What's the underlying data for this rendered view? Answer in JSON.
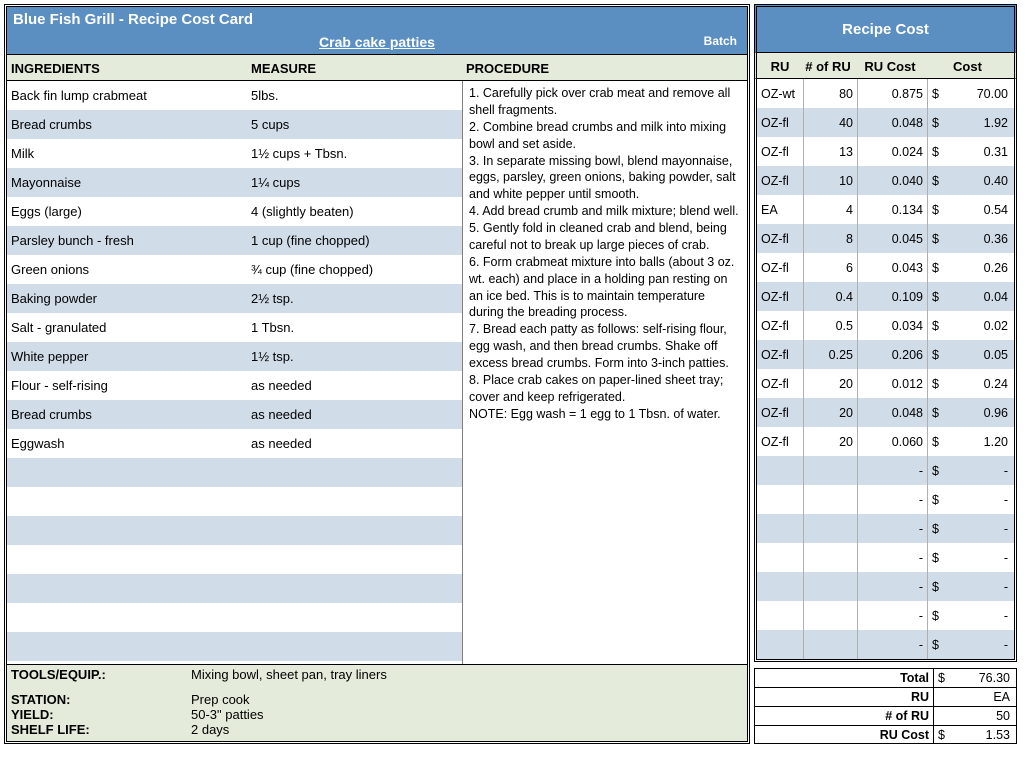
{
  "header": {
    "title": "Blue Fish Grill - Recipe Cost Card",
    "recipe_name": "Crab cake patties",
    "batch_label": "Batch"
  },
  "columns": {
    "ingredients": "INGREDIENTS",
    "measure": "MEASURE",
    "procedure": "PROCEDURE"
  },
  "ingredients": [
    {
      "name": "Back fin lump crabmeat",
      "measure": "5lbs."
    },
    {
      "name": "Bread crumbs",
      "measure": "5 cups"
    },
    {
      "name": "Milk",
      "measure": "1½ cups + Tbsn."
    },
    {
      "name": "Mayonnaise",
      "measure": "1¼ cups"
    },
    {
      "name": "Eggs (large)",
      "measure": "4 (slightly beaten)"
    },
    {
      "name": "Parsley bunch - fresh",
      "measure": "1 cup (fine chopped)"
    },
    {
      "name": "Green onions",
      "measure": "¾ cup (fine chopped)"
    },
    {
      "name": "Baking powder",
      "measure": "2½ tsp."
    },
    {
      "name": "Salt - granulated",
      "measure": "1 Tbsn."
    },
    {
      "name": "White pepper",
      "measure": "1½ tsp."
    },
    {
      "name": "Flour - self-rising",
      "measure": "as needed"
    },
    {
      "name": "Bread crumbs",
      "measure": "as needed"
    },
    {
      "name": "Eggwash",
      "measure": "as needed"
    },
    {
      "name": "",
      "measure": ""
    },
    {
      "name": "",
      "measure": ""
    },
    {
      "name": "",
      "measure": ""
    },
    {
      "name": "",
      "measure": ""
    },
    {
      "name": "",
      "measure": ""
    },
    {
      "name": "",
      "measure": ""
    },
    {
      "name": "",
      "measure": ""
    }
  ],
  "procedure": [
    "1. Carefully pick over crab meat and remove all shell fragments.",
    "2. Combine bread crumbs and milk into mixing bowl and set aside.",
    "3. In separate missing bowl, blend mayonnaise, eggs, parsley, green onions, baking powder, salt and white pepper until smooth.",
    "4. Add bread crumb and milk mixture; blend well.",
    "5. Gently fold in cleaned crab and blend, being careful not to break up large pieces of crab.",
    "6. Form crabmeat mixture into balls (about 3 oz. wt. each) and place in a holding pan resting on an ice bed. This is to maintain temperature during the breading process.",
    "7. Bread each patty as follows: self-rising flour, egg wash, and then bread crumbs. Shake off excess bread crumbs. Form into 3-inch patties.",
    "8. Place crab cakes on paper-lined sheet tray; cover and keep refrigerated.",
    "NOTE: Egg wash = 1 egg to 1 Tbsn. of water."
  ],
  "footer": {
    "tools_label": "TOOLS/EQUIP.:",
    "tools": "Mixing bowl, sheet pan, tray liners",
    "station_label": "STATION:",
    "station": "Prep cook",
    "yield_label": "YIELD:",
    "yield": "50-3\" patties",
    "shelf_label": "SHELF LIFE:",
    "shelf": "2 days"
  },
  "recipe_cost": {
    "title": "Recipe Cost",
    "cols": {
      "ru": "RU",
      "num_ru": "# of RU",
      "ru_cost": "RU Cost",
      "cost": "Cost"
    },
    "rows": [
      {
        "ru": "OZ-wt",
        "n": "80",
        "rc": "0.875",
        "c": "70.00"
      },
      {
        "ru": "OZ-fl",
        "n": "40",
        "rc": "0.048",
        "c": "1.92"
      },
      {
        "ru": "OZ-fl",
        "n": "13",
        "rc": "0.024",
        "c": "0.31"
      },
      {
        "ru": "OZ-fl",
        "n": "10",
        "rc": "0.040",
        "c": "0.40"
      },
      {
        "ru": "EA",
        "n": "4",
        "rc": "0.134",
        "c": "0.54"
      },
      {
        "ru": "OZ-fl",
        "n": "8",
        "rc": "0.045",
        "c": "0.36"
      },
      {
        "ru": "OZ-fl",
        "n": "6",
        "rc": "0.043",
        "c": "0.26"
      },
      {
        "ru": "OZ-fl",
        "n": "0.4",
        "rc": "0.109",
        "c": "0.04"
      },
      {
        "ru": "OZ-fl",
        "n": "0.5",
        "rc": "0.034",
        "c": "0.02"
      },
      {
        "ru": "OZ-fl",
        "n": "0.25",
        "rc": "0.206",
        "c": "0.05"
      },
      {
        "ru": "OZ-fl",
        "n": "20",
        "rc": "0.012",
        "c": "0.24"
      },
      {
        "ru": "OZ-fl",
        "n": "20",
        "rc": "0.048",
        "c": "0.96"
      },
      {
        "ru": "OZ-fl",
        "n": "20",
        "rc": "0.060",
        "c": "1.20"
      },
      {
        "ru": "",
        "n": "",
        "rc": "-",
        "c": "-"
      },
      {
        "ru": "",
        "n": "",
        "rc": "-",
        "c": "-"
      },
      {
        "ru": "",
        "n": "",
        "rc": "-",
        "c": "-"
      },
      {
        "ru": "",
        "n": "",
        "rc": "-",
        "c": "-"
      },
      {
        "ru": "",
        "n": "",
        "rc": "-",
        "c": "-"
      },
      {
        "ru": "",
        "n": "",
        "rc": "-",
        "c": "-"
      },
      {
        "ru": "",
        "n": "",
        "rc": "-",
        "c": "-"
      }
    ],
    "totals": {
      "total_label": "Total",
      "total": "76.30",
      "ru_label": "RU",
      "ru": "EA",
      "numru_label": "# of RU",
      "numru": "50",
      "rucost_label": "RU Cost",
      "rucost": "1.53"
    }
  }
}
